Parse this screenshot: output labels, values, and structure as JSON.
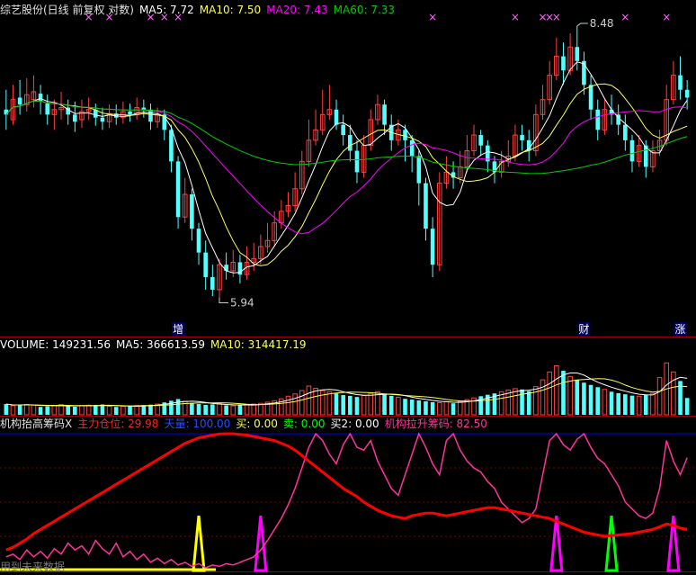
{
  "header_main": {
    "title": "综艺股份(日线 前复权 对数)",
    "ma5": "MA5: 7.72",
    "ma10": "MA10: 7.50",
    "ma20": "MA20: 7.43",
    "ma60": "MA60: 7.33"
  },
  "header_volume": {
    "volume": "VOLUME: 149231.56",
    "ma5": "MA5: 366613.59",
    "ma10": "MA10: 314417.19"
  },
  "header_indicator": {
    "name": "机构抬高筹码X",
    "main_position": "主力仓位: 29.98",
    "sky_top": "天量: 100.00",
    "buy": "买: 0.00",
    "sell": "卖: 0.00",
    "buy2": "买2: 0.00",
    "pull_chips": "机构拉升筹码: 82.50"
  },
  "annotations": {
    "high": "8.48",
    "low": "5.94"
  },
  "markers": [
    "增",
    "财",
    "涨"
  ],
  "footer": "用到未来数据",
  "colors": {
    "up": "#ff4040",
    "down": "#54ffff",
    "ma5": "#ffffff",
    "ma10": "#ffff54",
    "ma20": "#ff00ff",
    "ma60": "#00cc00",
    "main_position": "#ff0000",
    "pull_chips": "#ff3399",
    "sky_top": "#0000ff"
  },
  "chart_data": [
    {
      "type": "candlestick",
      "title": "综艺股份(日线 前复权 对数)",
      "price_range": [
        5.75,
        8.55
      ],
      "candles": [
        [
          7.6,
          7.55,
          7.8,
          7.4
        ],
        [
          7.5,
          7.7,
          7.85,
          7.45
        ],
        [
          7.72,
          7.65,
          7.9,
          7.55
        ],
        [
          7.65,
          7.75,
          7.92,
          7.58
        ],
        [
          7.7,
          7.78,
          7.95,
          7.62
        ],
        [
          7.76,
          7.68,
          7.85,
          7.55
        ],
        [
          7.66,
          7.55,
          7.75,
          7.45
        ],
        [
          7.55,
          7.6,
          7.7,
          7.4
        ],
        [
          7.6,
          7.62,
          7.78,
          7.5
        ],
        [
          7.62,
          7.55,
          7.7,
          7.45
        ],
        [
          7.55,
          7.48,
          7.68,
          7.38
        ],
        [
          7.5,
          7.58,
          7.7,
          7.42
        ],
        [
          7.58,
          7.6,
          7.72,
          7.5
        ],
        [
          7.6,
          7.52,
          7.66,
          7.44
        ],
        [
          7.52,
          7.48,
          7.62,
          7.4
        ],
        [
          7.48,
          7.56,
          7.65,
          7.42
        ],
        [
          7.56,
          7.52,
          7.65,
          7.45
        ],
        [
          7.52,
          7.58,
          7.68,
          7.46
        ],
        [
          7.58,
          7.55,
          7.66,
          7.48
        ],
        [
          7.55,
          7.62,
          7.72,
          7.5
        ],
        [
          7.62,
          7.6,
          7.7,
          7.52
        ],
        [
          7.6,
          7.48,
          7.66,
          7.4
        ],
        [
          7.48,
          7.55,
          7.62,
          7.42
        ],
        [
          7.55,
          7.4,
          7.6,
          7.3
        ],
        [
          7.4,
          7.1,
          7.45,
          7.0
        ],
        [
          7.1,
          6.6,
          7.15,
          6.5
        ],
        [
          6.6,
          6.8,
          6.95,
          6.55
        ],
        [
          6.8,
          6.5,
          6.85,
          6.4
        ],
        [
          6.5,
          6.3,
          6.55,
          6.2
        ],
        [
          6.3,
          6.1,
          6.4,
          6.0
        ],
        [
          6.1,
          6.0,
          6.2,
          5.95
        ],
        [
          6.0,
          6.2,
          6.25,
          5.94
        ],
        [
          6.2,
          6.15,
          6.3,
          6.08
        ],
        [
          6.15,
          6.22,
          6.32,
          6.1
        ],
        [
          6.22,
          6.12,
          6.28,
          6.05
        ],
        [
          6.12,
          6.22,
          6.35,
          6.08
        ],
        [
          6.22,
          6.25,
          6.38,
          6.15
        ],
        [
          6.25,
          6.35,
          6.45,
          6.2
        ],
        [
          6.35,
          6.4,
          6.55,
          6.3
        ],
        [
          6.4,
          6.55,
          6.65,
          6.35
        ],
        [
          6.55,
          6.65,
          6.75,
          6.5
        ],
        [
          6.65,
          6.7,
          6.82,
          6.6
        ],
        [
          6.7,
          6.85,
          7.0,
          6.65
        ],
        [
          6.85,
          7.1,
          7.2,
          6.8
        ],
        [
          7.1,
          7.3,
          7.5,
          7.05
        ],
        [
          7.3,
          7.4,
          7.6,
          7.25
        ],
        [
          7.4,
          7.55,
          7.8,
          7.35
        ],
        [
          7.55,
          7.6,
          7.85,
          7.5
        ],
        [
          7.6,
          7.45,
          7.7,
          7.4
        ],
        [
          7.45,
          7.35,
          7.55,
          7.25
        ],
        [
          7.35,
          7.2,
          7.45,
          7.1
        ],
        [
          7.2,
          7.0,
          7.3,
          6.9
        ],
        [
          7.0,
          7.25,
          7.35,
          6.95
        ],
        [
          7.25,
          7.5,
          7.6,
          7.2
        ],
        [
          7.5,
          7.65,
          7.75,
          7.45
        ],
        [
          7.65,
          7.45,
          7.7,
          7.35
        ],
        [
          7.45,
          7.3,
          7.55,
          7.2
        ],
        [
          7.3,
          7.4,
          7.5,
          7.25
        ],
        [
          7.4,
          7.3,
          7.45,
          7.1
        ],
        [
          7.3,
          7.15,
          7.35,
          7.0
        ],
        [
          7.15,
          6.9,
          7.2,
          6.7
        ],
        [
          6.9,
          6.5,
          6.95,
          6.4
        ],
        [
          6.5,
          6.2,
          6.6,
          6.1
        ],
        [
          6.2,
          6.9,
          7.0,
          6.15
        ],
        [
          6.9,
          7.0,
          7.15,
          6.85
        ],
        [
          7.0,
          6.95,
          7.1,
          6.85
        ],
        [
          6.95,
          7.05,
          7.2,
          6.9
        ],
        [
          7.05,
          7.2,
          7.35,
          7.0
        ],
        [
          7.2,
          7.35,
          7.45,
          7.15
        ],
        [
          7.35,
          7.25,
          7.4,
          7.15
        ],
        [
          7.25,
          7.1,
          7.3,
          7.0
        ],
        [
          7.1,
          7.0,
          7.15,
          6.9
        ],
        [
          7.0,
          7.1,
          7.2,
          6.95
        ],
        [
          7.1,
          7.15,
          7.3,
          7.05
        ],
        [
          7.15,
          7.35,
          7.45,
          7.1
        ],
        [
          7.35,
          7.3,
          7.45,
          7.2
        ],
        [
          7.3,
          7.2,
          7.4,
          7.1
        ],
        [
          7.2,
          7.55,
          7.65,
          7.15
        ],
        [
          7.55,
          7.7,
          7.85,
          7.5
        ],
        [
          7.7,
          7.95,
          8.1,
          7.65
        ],
        [
          7.95,
          8.15,
          8.35,
          7.9
        ],
        [
          8.15,
          8.0,
          8.3,
          7.85
        ],
        [
          8.0,
          8.25,
          8.4,
          7.95
        ],
        [
          8.25,
          8.1,
          8.48,
          8.0
        ],
        [
          8.1,
          7.85,
          8.2,
          7.75
        ],
        [
          7.85,
          7.6,
          7.95,
          7.5
        ],
        [
          7.6,
          7.4,
          7.7,
          7.3
        ],
        [
          7.4,
          7.6,
          7.7,
          7.35
        ],
        [
          7.6,
          7.55,
          7.75,
          7.45
        ],
        [
          7.55,
          7.45,
          7.65,
          7.35
        ],
        [
          7.45,
          7.3,
          7.55,
          7.2
        ],
        [
          7.3,
          7.1,
          7.35,
          7.0
        ],
        [
          7.1,
          7.25,
          7.35,
          7.05
        ],
        [
          7.25,
          7.05,
          7.3,
          6.95
        ],
        [
          7.05,
          7.2,
          7.3,
          7.0
        ],
        [
          7.2,
          7.3,
          7.4,
          7.15
        ],
        [
          7.3,
          7.7,
          7.85,
          7.25
        ],
        [
          7.7,
          7.95,
          8.1,
          7.65
        ],
        [
          7.95,
          7.8,
          8.15,
          7.7
        ],
        [
          7.8,
          7.72,
          7.9,
          7.6
        ]
      ],
      "ma_legend": [
        "MA5: 7.72",
        "MA10: 7.50",
        "MA20: 7.43",
        "MA60: 7.33"
      ],
      "high_label": "8.48",
      "low_label": "5.94"
    },
    {
      "type": "bar",
      "title": "VOLUME: 149231.56",
      "value_range": [
        0,
        550000
      ],
      "values": [
        95000,
        80000,
        88000,
        92000,
        85000,
        70000,
        75000,
        82000,
        90000,
        78000,
        72000,
        80000,
        85000,
        88000,
        92000,
        76000,
        70000,
        74000,
        78000,
        82000,
        86000,
        90000,
        95000,
        110000,
        125000,
        140000,
        120000,
        105000,
        96000,
        88000,
        92000,
        98000,
        84000,
        80000,
        86000,
        90000,
        95000,
        102000,
        112000,
        125000,
        142000,
        165000,
        185000,
        215000,
        255000,
        235000,
        215000,
        205000,
        190000,
        175000,
        168000,
        158000,
        172000,
        190000,
        205000,
        182000,
        168000,
        155000,
        142000,
        135000,
        128000,
        120000,
        112000,
        108000,
        115000,
        102000,
        118000,
        135000,
        150000,
        165000,
        178000,
        190000,
        205000,
        220000,
        232000,
        225000,
        210000,
        250000,
        310000,
        380000,
        435000,
        390000,
        340000,
        310000,
        285000,
        265000,
        245000,
        225000,
        205000,
        192000,
        182000,
        170000,
        165000,
        175000,
        190000,
        330000,
        460000,
        380000,
        300000,
        149231.56
      ],
      "ma5_label": "MA5: 366613.59",
      "ma10_label": "MA10: 314417.19"
    },
    {
      "type": "line",
      "title": "机构抬高筹码X",
      "value_range": [
        0,
        100
      ],
      "series": [
        {
          "name": "主力仓位",
          "values": [
            15,
            17,
            20,
            23,
            27,
            30,
            33,
            36,
            39,
            42,
            45,
            48,
            51,
            54,
            57,
            60,
            63,
            66,
            69,
            72,
            75,
            78,
            81,
            84,
            87,
            90,
            93,
            95,
            97,
            98,
            99,
            99.8,
            100,
            100,
            99.5,
            99,
            98,
            97,
            96,
            95,
            93,
            91,
            88,
            84,
            80,
            76,
            72,
            68,
            64,
            60,
            57,
            54,
            50,
            47,
            44,
            42,
            40,
            39,
            38,
            40,
            41,
            42,
            42,
            41,
            40,
            41,
            42,
            43,
            44,
            45,
            46,
            46,
            45,
            44,
            43,
            42,
            41,
            40,
            39,
            38,
            36,
            34,
            32,
            30,
            28,
            27,
            26,
            25,
            25.5,
            26,
            26.5,
            27,
            28,
            29,
            30,
            32,
            34,
            33,
            31,
            29.98
          ]
        },
        {
          "name": "机构拉升筹码",
          "values": [
            10,
            12,
            8,
            15,
            10,
            14,
            9,
            16,
            12,
            20,
            15,
            18,
            12,
            22,
            16,
            12,
            20,
            10,
            14,
            8,
            12,
            6,
            9,
            5,
            8,
            4,
            6,
            3,
            5,
            2,
            4,
            3,
            5,
            4,
            6,
            8,
            10,
            15,
            22,
            30,
            38,
            48,
            60,
            75,
            90,
            100,
            95,
            85,
            78,
            92,
            100,
            90,
            88,
            95,
            80,
            70,
            60,
            55,
            70,
            85,
            100,
            90,
            78,
            70,
            95,
            100,
            88,
            80,
            75,
            72,
            65,
            60,
            50,
            45,
            40,
            35,
            38,
            45,
            70,
            95,
            100,
            92,
            88,
            96,
            100,
            90,
            82,
            78,
            70,
            62,
            50,
            45,
            40,
            38,
            42,
            60,
            95,
            80,
            70,
            82.5
          ]
        },
        {
          "name": "天量",
          "values": "constant 100"
        }
      ],
      "signals": {
        "yellow_spike_index": 28,
        "magenta_spike_indices": [
          37,
          80,
          97
        ],
        "green_spike_indices": [
          88
        ]
      },
      "legend": [
        "主力仓位: 29.98",
        "天量: 100.00",
        "买: 0.00",
        "卖: 0.00",
        "买2: 0.00",
        "机构拉升筹码: 82.50"
      ]
    }
  ]
}
